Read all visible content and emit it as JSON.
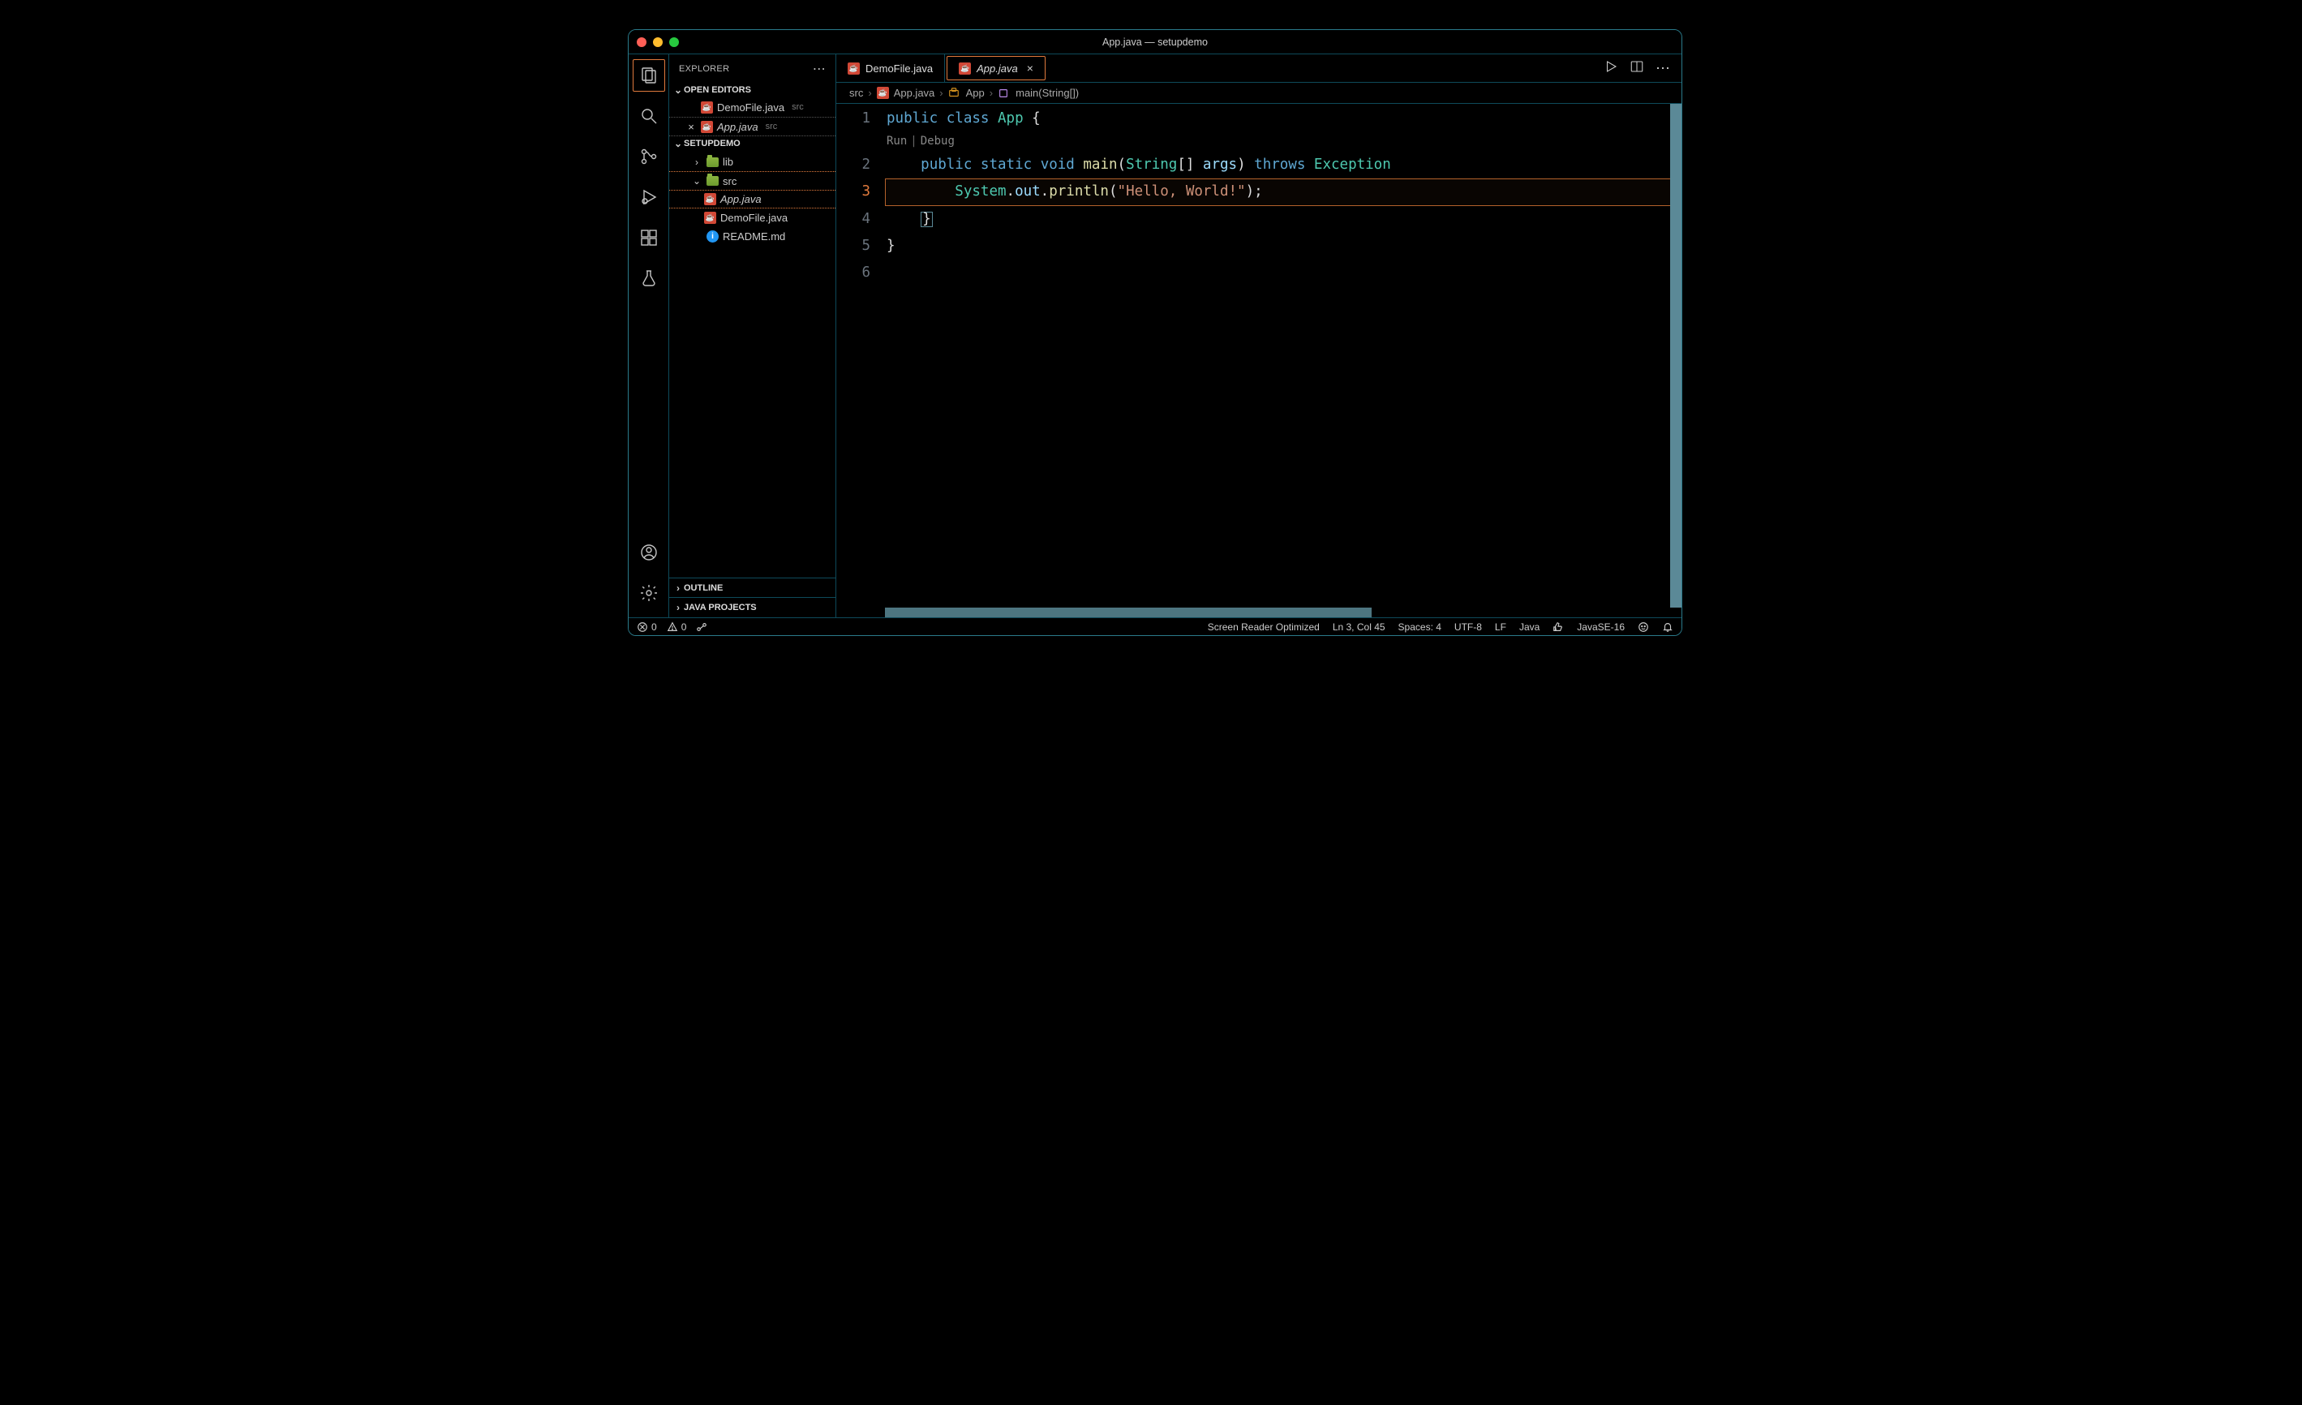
{
  "title": "App.java — setupdemo",
  "sidebar": {
    "header": "EXPLORER",
    "open_editors": {
      "label": "OPEN EDITORS",
      "items": [
        {
          "name": "DemoFile.java",
          "tag": "src"
        },
        {
          "name": "App.java",
          "tag": "src"
        }
      ]
    },
    "project": {
      "label": "SETUPDEMO",
      "tree": {
        "lib": "lib",
        "src": "src",
        "app": "App.java",
        "demo": "DemoFile.java",
        "readme": "README.md"
      }
    },
    "outline": "OUTLINE",
    "java_projects": "JAVA PROJECTS"
  },
  "tabs": [
    {
      "name": "DemoFile.java",
      "active": false
    },
    {
      "name": "App.java",
      "active": true
    }
  ],
  "breadcrumb": {
    "p0": "src",
    "p1": "App.java",
    "p2": "App",
    "p3": "main(String[])"
  },
  "codelens": {
    "run": "Run",
    "debug": "Debug"
  },
  "code": {
    "l1_a": "public",
    "l1_b": "class",
    "l1_c": "App",
    "l1_d": "{",
    "l2_a": "public",
    "l2_b": "static",
    "l2_c": "void",
    "l2_d": "main",
    "l2_e": "String",
    "l2_f": "args",
    "l2_g": "throws",
    "l2_h": "Exception",
    "l3_a": "System",
    "l3_b": "out",
    "l3_c": "println",
    "l3_d": "\"Hello, World!\"",
    "l4": "}",
    "l5": "}",
    "ln1": "1",
    "ln2": "2",
    "ln3": "3",
    "ln4": "4",
    "ln5": "5",
    "ln6": "6"
  },
  "status": {
    "errors": "0",
    "warnings": "0",
    "screenreader": "Screen Reader Optimized",
    "cursor": "Ln 3, Col 45",
    "spaces": "Spaces: 4",
    "encoding": "UTF-8",
    "eol": "LF",
    "lang": "Java",
    "jdk": "JavaSE-16"
  }
}
